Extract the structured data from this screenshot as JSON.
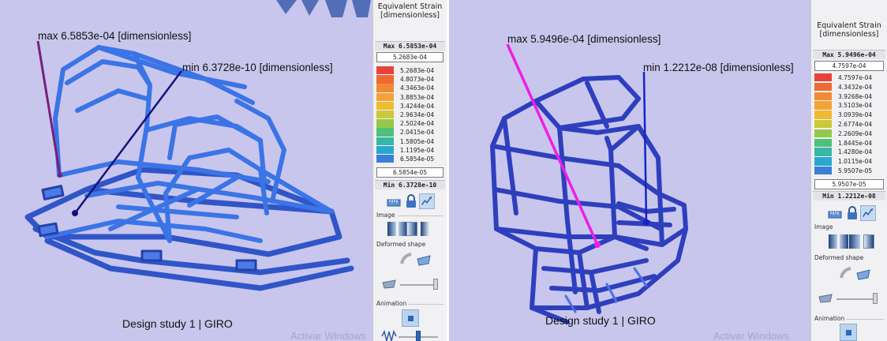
{
  "colors": {
    "viewport_bg": "#c8c6ec",
    "frame_blue": "#3a6fe0",
    "frame_dark": "#2d3fb8",
    "legend_bg": "#f1f1f3",
    "scale": [
      "#e8433a",
      "#ec6a34",
      "#f08a35",
      "#f3a336",
      "#efbb33",
      "#c9c93a",
      "#94c84a",
      "#4fc07a",
      "#35b8a6",
      "#2aa7cc",
      "#3a7fd8"
    ]
  },
  "left": {
    "watermark": "Activar Windows",
    "caption": "Design study 1 | GIRO",
    "max_label": "max 6.5853e-04 [dimensionless]",
    "min_label": "min 6.3728e-10 [dimensionless]",
    "legend": {
      "title_line1": "Equivalent Strain",
      "title_line2": "[dimensionless]",
      "max_text": "Max 6.5853e-04",
      "top_value": "5.2683e-04",
      "ticks": [
        "5.2683e-04",
        "4.8073e-04",
        "4.3463e-04",
        "3.8853e-04",
        "3.4244e-04",
        "2.9634e-04",
        "2.5024e-04",
        "2.0415e-04",
        "1.5805e-04",
        "1.1195e-04",
        "6.5854e-05"
      ],
      "bottom_value": "6.5854e-05",
      "min_text": "Min 6.3728e-10",
      "image_label": "Image",
      "deformed_label": "Deformed shape",
      "animation_label": "Animation",
      "icons": [
        "ruler-icon",
        "lock-icon",
        "probe-icon",
        "image-gradient-icon",
        "deformed-shape-icon",
        "animation-play-icon",
        "waveform-icon"
      ]
    }
  },
  "right": {
    "watermark": "Activar Windows",
    "caption": "Design study 1 | GIRO",
    "max_label": "max 5.9496e-04 [dimensionless]",
    "min_label": "min 1.2212e-08 [dimensionless]",
    "legend": {
      "title_line1": "Equivalent Strain",
      "title_line2": "[dimensionless]",
      "max_text": "Max 5.9496e-04",
      "top_value": "4.7597e-04",
      "ticks": [
        "4.7597e-04",
        "4.3432e-04",
        "3.9268e-04",
        "3.5103e-04",
        "3.0939e-04",
        "2.6774e-04",
        "2.2609e-04",
        "1.8445e-04",
        "1.4280e-04",
        "1.0115e-04",
        "5.9507e-05"
      ],
      "bottom_value": "5.9507e-05",
      "min_text": "Min 1.2212e-08",
      "image_label": "Image",
      "deformed_label": "Deformed shape",
      "animation_label": "Animation"
    }
  }
}
